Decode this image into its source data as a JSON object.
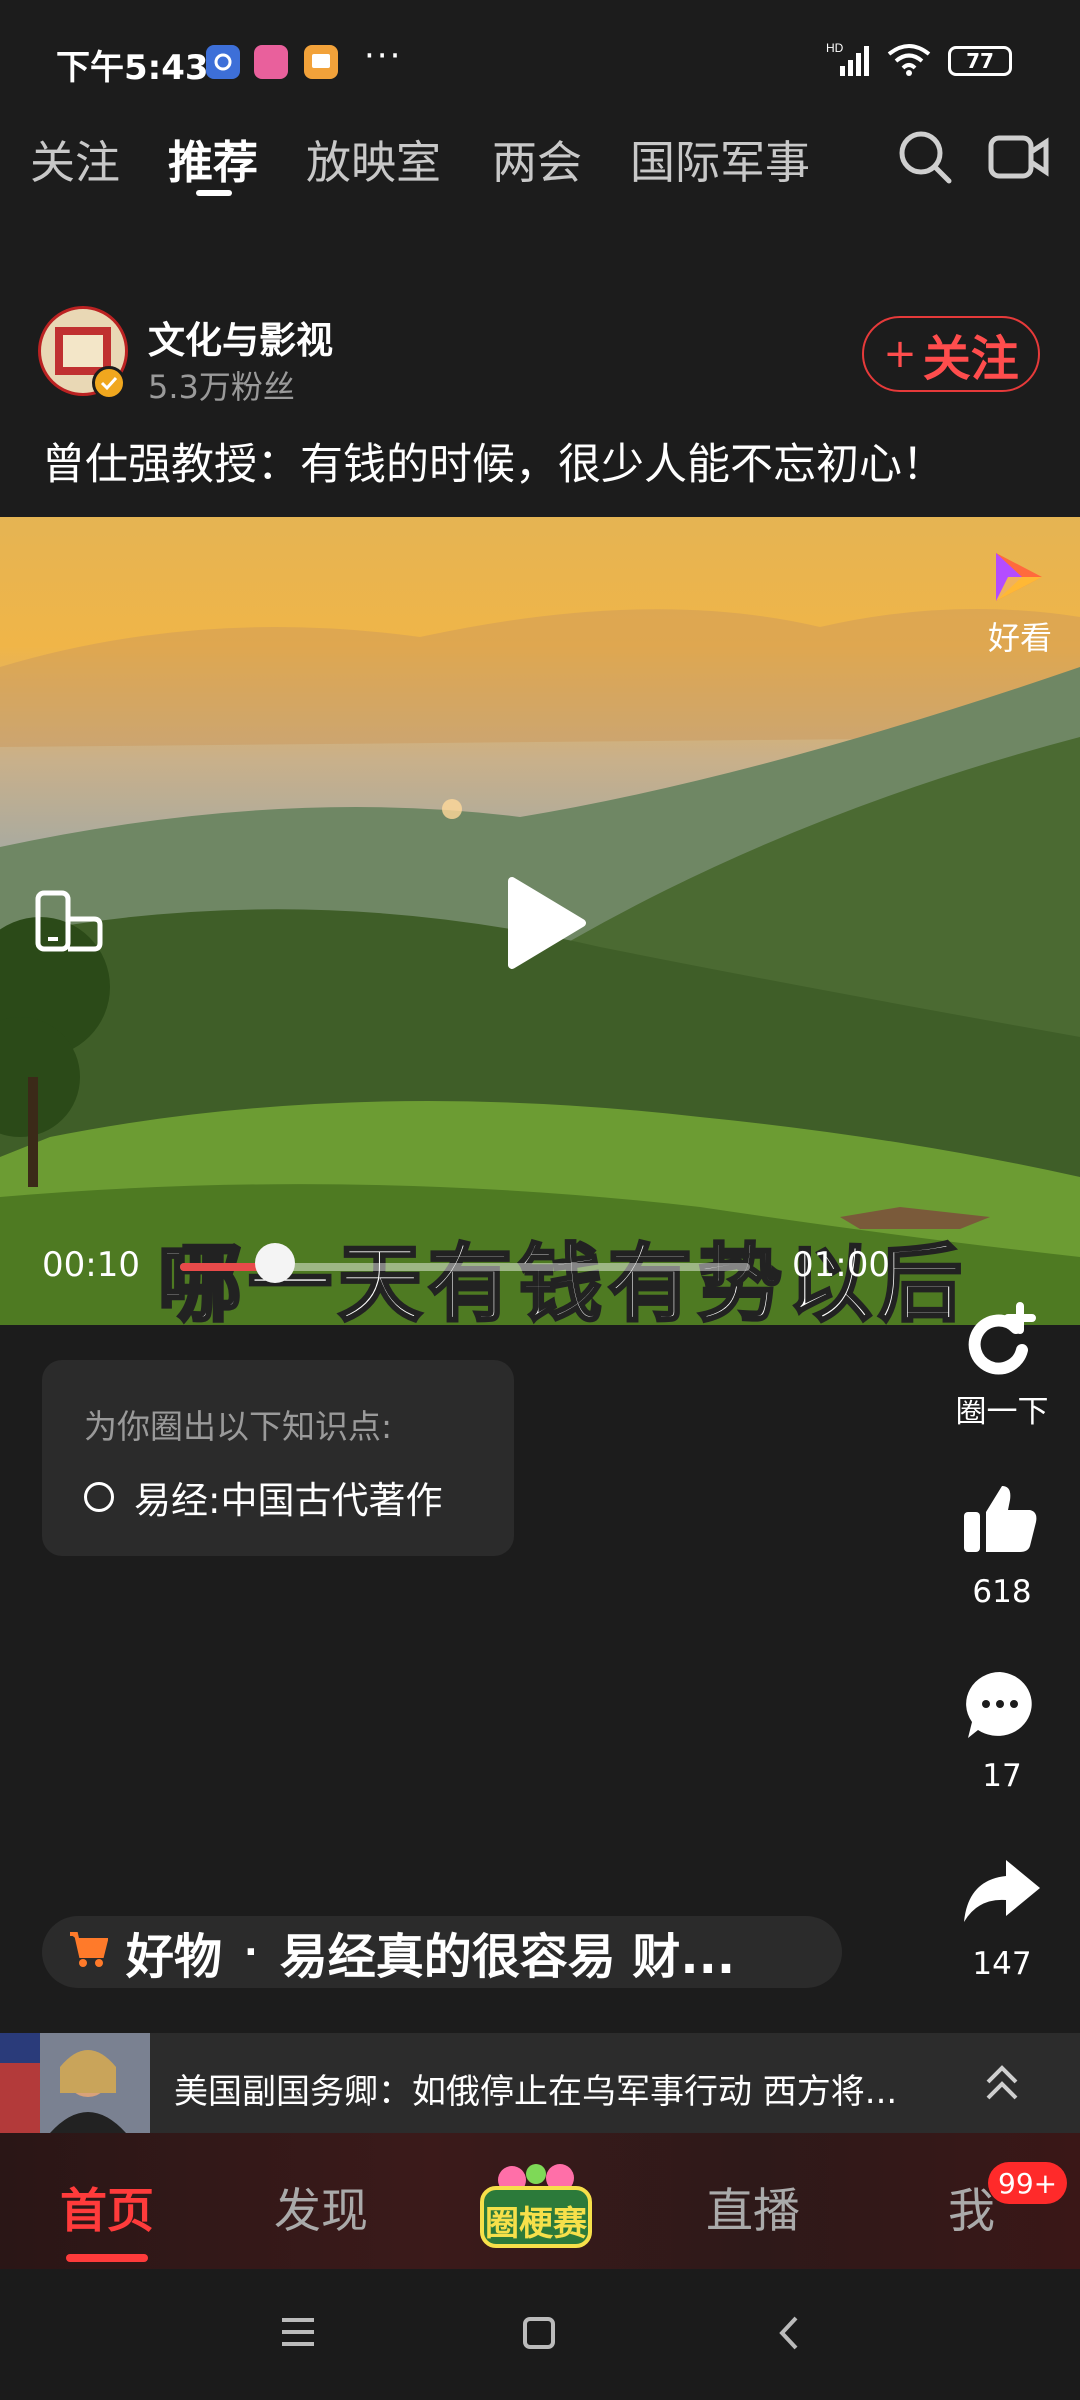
{
  "status_bar": {
    "time": "下午5:43",
    "more": "···",
    "network": "HD",
    "battery": "77"
  },
  "top_tabs": [
    "关注",
    "推荐",
    "放映室",
    "两会",
    "国际军事"
  ],
  "author": {
    "name": "文化与影视",
    "fans": "5.3万粉丝",
    "follow_label": "关注",
    "follow_plus": "+"
  },
  "post": {
    "title": "曾仕强教授：有钱的时候，很少人能不忘初心！"
  },
  "video": {
    "subtitle": "哪一天有钱有势以后",
    "current_time": "00:10",
    "total_time": "01:00",
    "progress_fraction": 0.1667,
    "brand_label": "好看"
  },
  "actions": {
    "circle_label": "圈一下",
    "likes": "618",
    "comments": "17",
    "shares": "147"
  },
  "knowledge": {
    "title": "为你圈出以下知识点:",
    "item": "易经:中国古代著作"
  },
  "goods": {
    "label": "好物",
    "sep": "·",
    "text": "易经真的很容易 财..."
  },
  "news": {
    "text": "美国副国务卿：如俄停止在乌军事行动 西方将..."
  },
  "bottom_nav": {
    "home": "首页",
    "discover": "发现",
    "event": "圈梗赛",
    "live": "直播",
    "me": "我",
    "badge": "99+"
  },
  "colors": {
    "accent": "#ff3b3b",
    "background": "#1c1c1c",
    "card": "#2b2b2b"
  }
}
